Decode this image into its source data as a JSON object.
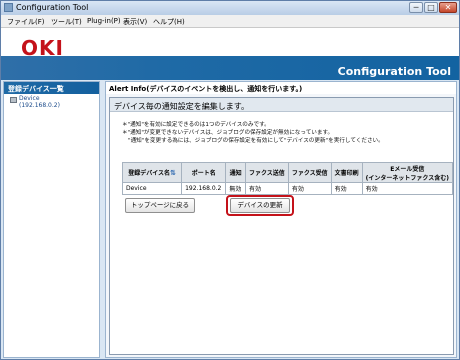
{
  "window": {
    "title": "Configuration Tool",
    "minimize": "─",
    "maximize": "□",
    "close": "✕"
  },
  "menu": [
    "ファイル(F)",
    "ツール(T)",
    "Plug-in(P)",
    "表示(V)",
    "ヘルプ(H)"
  ],
  "brand": {
    "logo": "OKI",
    "product_title": "Configuration Tool",
    "accent_color": "#c4121a",
    "band_color": "#1f6aa6"
  },
  "sidebar": {
    "title": "登録デバイス一覧",
    "devices": [
      {
        "name": "Device",
        "ip": "(192.168.0.2)",
        "icon": "printer-icon"
      }
    ]
  },
  "main": {
    "heading": "Alert Info(デバイスのイベントを検出し、通知を行います。)",
    "section_title": "デバイス毎の通知設定を編集します。",
    "notes": [
      "＊\"通知\"を有効に設定できるのは1つのデバイスのみです。",
      "＊\"通知\"が変更できないデバイスは、ジョブログの保存設定が無効になっています。",
      "\"通知\"を変更する為には、ジョブログの保存設定を有効にして\"デバイスの更新\"を実行してください。"
    ],
    "table": {
      "headers": [
        "登録デバイス名",
        "ポート名",
        "通知",
        "ファクス送信",
        "ファクス受信",
        "文書印刷",
        "Eメール受信",
        "(インターネットファクス含む)"
      ],
      "sort_icon": "⇅",
      "rows": [
        [
          "Device",
          "192.168.0.2",
          "無効",
          "有効",
          "有効",
          "有効",
          "有効"
        ]
      ]
    },
    "buttons": {
      "top_page": "トップページに戻る",
      "update_device": "デバイスの更新"
    }
  }
}
